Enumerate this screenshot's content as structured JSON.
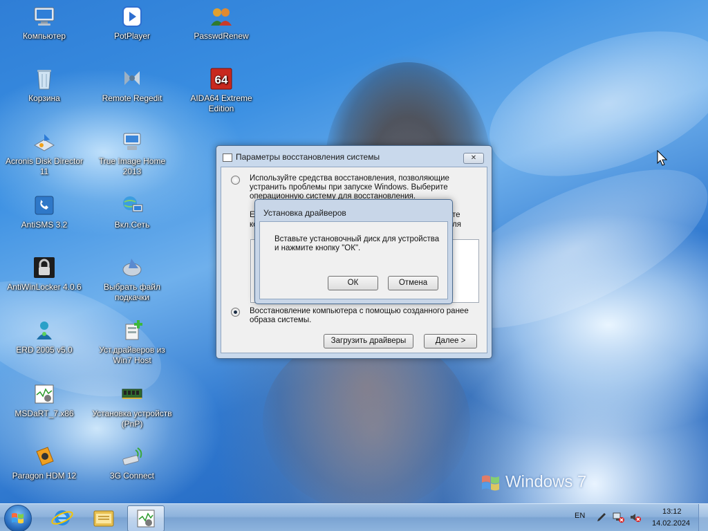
{
  "desktop": {
    "icons": [
      {
        "label": "Компьютер"
      },
      {
        "label": "PotPlayer"
      },
      {
        "label": "PasswdRenew"
      },
      {
        "label": "Корзина"
      },
      {
        "label": "Remote Regedit"
      },
      {
        "label": "AIDA64 Extreme Edition"
      },
      {
        "label": "Acronis Disk Director 11"
      },
      {
        "label": "True Image Home 2013"
      },
      {
        "label": "AntiSMS 3.2"
      },
      {
        "label": "Вкл.Сеть"
      },
      {
        "label": "AntiWinLocker 4.0.6"
      },
      {
        "label": "Выбрать файл подкачки"
      },
      {
        "label": "ERD 2005 v5.0"
      },
      {
        "label": "Уст.драйверов из Win7 Host"
      },
      {
        "label": "MSDaRT_7.x86"
      },
      {
        "label": "Установка устройств (PnP)"
      },
      {
        "label": "Paragon HDM 12"
      },
      {
        "label": "3G Connect"
      }
    ],
    "branding": "Windows 7"
  },
  "recovery_dialog": {
    "title": "Параметры восстановления системы",
    "close": "✕",
    "option1_text": "Используйте средства восстановления, позволяющие устранить проблемы при запуске Windows. Выберите операционную систему для восстановления.",
    "hidden_line1_start": "Ес",
    "hidden_line1_end": "те",
    "hidden_line2_start": "ко",
    "hidden_line2_end": "ля",
    "option2_text": "Восстановление компьютера с помощью созданного ранее образа системы.",
    "load_drivers_button": "Загрузить драйверы",
    "next_button": "Далее >"
  },
  "driver_dialog": {
    "title": "Установка драйверов",
    "message": "Вставьте установочный диск для устройства и нажмите кнопку \"ОК\".",
    "ok_button": "ОК",
    "cancel_button": "Отмена"
  },
  "taskbar": {
    "language": "EN",
    "time": "13:12",
    "date": "14.02.2024"
  }
}
